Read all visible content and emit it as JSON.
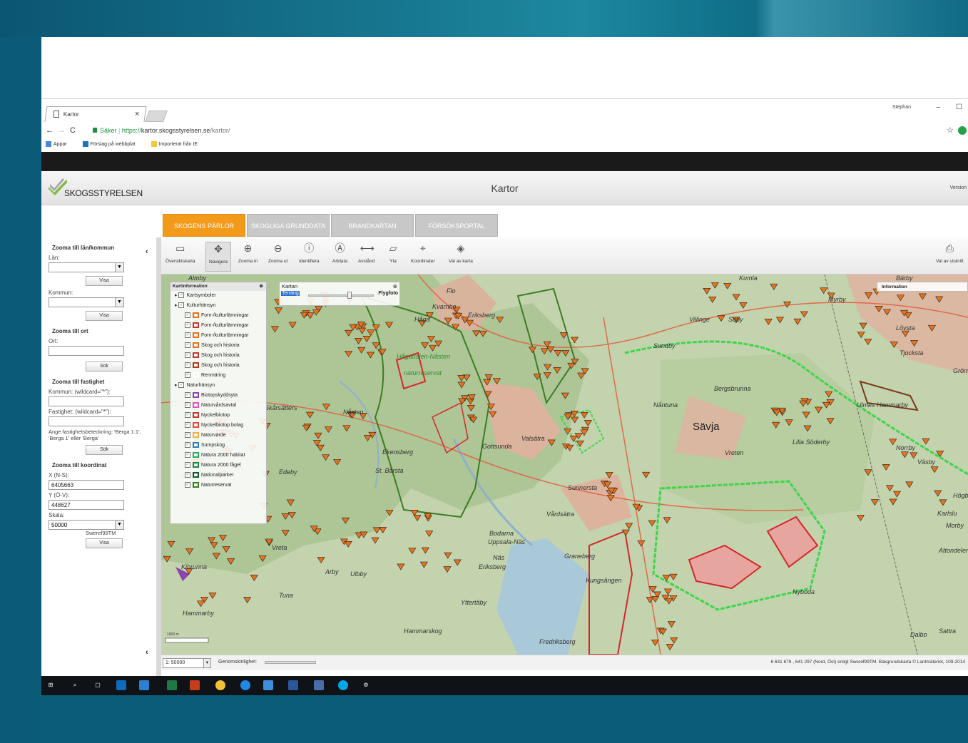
{
  "browser": {
    "tab_title": "Kartor",
    "tab_close": "×",
    "user": "Stephan",
    "win_min": "–",
    "win_max": "☐",
    "secure_label": "Säker",
    "url_scheme": "https://",
    "url_host": "kartor.skogsstyrelsen.se",
    "url_path": "/kartor/",
    "bookmarks": [
      "Appar",
      "Förslag på webbplat",
      "Importerat från IE"
    ]
  },
  "header": {
    "logo_text": "SKOGSSTYRELSEN",
    "title": "Kartor",
    "version_label": "Version"
  },
  "tabs": [
    "SKOGENS PÄRLOR",
    "SKOGLIGA GRUNDDATA",
    "BRANDKARTAN",
    "FÖRSÖKSPORTAL"
  ],
  "left_panel": {
    "zoom_lan_heading": "Zooma till län/kommun",
    "lan_label": "Län:",
    "kommun_label": "Kommun:",
    "visa": "Visa",
    "zoom_ort_heading": "Zooma till ort",
    "ort_label": "Ort:",
    "sok": "Sök",
    "zoom_fastighet_heading": "Zooma till fastighet",
    "fast_kommun_label": "Kommun: (wildcard=\"*\"):",
    "fastighet_label": "Fastighet: (wildcard=\"*\"):",
    "fast_note": "Ange fastighetsbeteckning: 'Berga 1:1', 'Berga 1' eller 'Berga'",
    "zoom_koord_heading": "Zooma till koordinat",
    "x_label": "X (N-S):",
    "x_value": "6405663",
    "y_label": "Y (Ö-V):",
    "y_value": "448627",
    "skala_label": "Skala:",
    "skala_value": "50000",
    "crs": "Sweref99TM",
    "collapse": "‹"
  },
  "toolbar": {
    "tools": [
      {
        "label": "Översiktskarta",
        "icon": "overview-map-icon"
      },
      {
        "label": "Navigera",
        "icon": "pan-icon"
      },
      {
        "label": "Zooma in",
        "icon": "zoom-in-icon"
      },
      {
        "label": "Zooma ut",
        "icon": "zoom-out-icon"
      },
      {
        "label": "Identifiera",
        "icon": "info-icon"
      },
      {
        "label": "Artdata",
        "icon": "species-icon"
      },
      {
        "label": "Avstånd",
        "icon": "ruler-icon"
      },
      {
        "label": "Yta",
        "icon": "area-icon"
      },
      {
        "label": "Koordinater",
        "icon": "crosshair-icon"
      },
      {
        "label": "Val av karta",
        "icon": "map-layers-icon"
      }
    ],
    "print_label": "Val av utskrift"
  },
  "kartinfo": {
    "title": "Kartinformation",
    "items": [
      {
        "label": "Kartsymboler",
        "level": 0,
        "color": ""
      },
      {
        "label": "Kulturhänsyn",
        "level": 0,
        "color": ""
      },
      {
        "label": "Forn-/kulturlämningar",
        "level": 1,
        "color": "#e8731c"
      },
      {
        "label": "Forn-/kulturlämningar",
        "level": 1,
        "color": "#c0392b"
      },
      {
        "label": "Forn-/kulturlämningar",
        "level": 1,
        "color": "#e8731c"
      },
      {
        "label": "Skog och historia",
        "level": 1,
        "color": "#e8731c"
      },
      {
        "label": "Skog och historia",
        "level": 1,
        "color": "#c0392b"
      },
      {
        "label": "Skog och historia",
        "level": 1,
        "color": "#b03a1a"
      },
      {
        "label": "Renmäring",
        "level": 1,
        "color": "#ffffff"
      },
      {
        "label": "Naturhänsyn",
        "level": 0,
        "color": ""
      },
      {
        "label": "Biotopskyddsyta",
        "level": 1,
        "color": "#8e44ad"
      },
      {
        "label": "Naturvårdsavtal",
        "level": 1,
        "color": "#e056c2"
      },
      {
        "label": "Nyckelbiotop",
        "level": 1,
        "color": "#c0392b"
      },
      {
        "label": "Nyckelbiotop bolag",
        "level": 1,
        "color": "#e74c3c"
      },
      {
        "label": "Naturvärde",
        "level": 1,
        "color": "#f5b041"
      },
      {
        "label": "Sumpskog",
        "level": 1,
        "color": "#2980b9"
      },
      {
        "label": "Natura 2000 habitat",
        "level": 1,
        "color": "#27ae60"
      },
      {
        "label": "Natura 2000 fågel",
        "level": 1,
        "color": "#1e8449"
      },
      {
        "label": "Nationalparker",
        "level": 1,
        "color": "#145a32"
      },
      {
        "label": "Naturreservat",
        "level": 1,
        "color": "#3b7d23"
      }
    ]
  },
  "kartan": {
    "title": "Kartan",
    "left_label": "Terräng",
    "right_label": "Flygfoto"
  },
  "info_panel": {
    "title": "Information"
  },
  "map_labels": [
    "Almby",
    "Flo",
    "Kvarnbo",
    "Eriksberg",
    "Håga",
    "Hågadalen-Nåsten",
    "naturreservat",
    "Nåsten",
    "Skårsätters",
    "Gottsunda",
    "Valsätra",
    "Ekensberg",
    "Edeby",
    "Ulleråker",
    "St. Bärsta",
    "Sunnersta",
    "Vårdsätra",
    "Bodarna",
    "Uppsala-Näs",
    "Näs",
    "Graneberg",
    "Kungsängen",
    "Eriksberg",
    "Yttertäby",
    "Vreta",
    "Kibrunna",
    "Arby",
    "Ulbby",
    "Tuna",
    "Hammarskog",
    "Hammarby",
    "Fredriksberg",
    "Sävja",
    "Nåntuna",
    "Bergsbrunna",
    "Sundby",
    "Villinge",
    "Säby",
    "Lövsta",
    "Tjocksta",
    "Bärby",
    "Kumla",
    "Myrby",
    "Nyboda",
    "Dalbo",
    "Sattra",
    "Lilla Söderby",
    "Vreten",
    "Ulmes Hammarby",
    "Norrby",
    "Väsby",
    "Karlslu",
    "Morby",
    "Attondeleri",
    "Högby",
    "Grönv"
  ],
  "status": {
    "scale": "1: 50000",
    "transparency_label": "Genomskinlighet:",
    "coords": "6 631 879 , 641 297 (Nord, Öst) enligt Sweref99TM. Bakgrundskarta © Lantmäteriet, 109-2014"
  },
  "scalebar": "1000 m",
  "colors": {
    "accent": "#f39a1b",
    "page_bg": "#0c5b78",
    "symbol": "#e8731c",
    "reserve": "#3aa02b",
    "natura": "#3dd64a",
    "key_biotope": "#d6262b"
  }
}
